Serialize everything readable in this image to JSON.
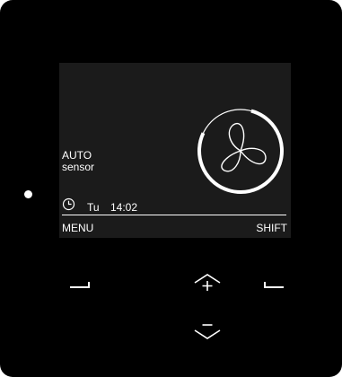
{
  "display": {
    "mode": "AUTO",
    "submode": "sensor",
    "day": "Tu",
    "time": "14:02",
    "left_softkey": "MENU",
    "right_softkey": "SHIFT",
    "fan_level": 0.85
  },
  "icons": {
    "clock": "clock-icon",
    "fan": "fan-icon",
    "increase": "chevron-up-plus-icon",
    "decrease": "chevron-down-minus-icon"
  },
  "colors": {
    "panel": "#000000",
    "screen": "#1b1b1b",
    "foreground": "#ffffff"
  }
}
